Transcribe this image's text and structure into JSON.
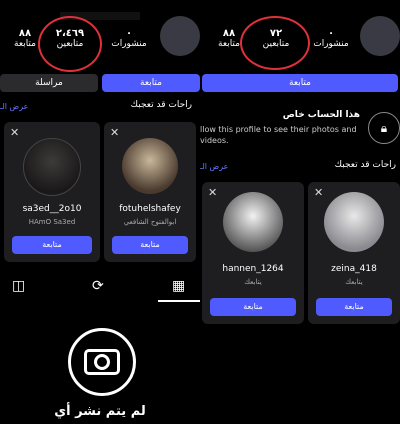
{
  "left": {
    "stats": {
      "posts_count": "٠",
      "posts_label": "منشورات",
      "followers_count": "٢،٤٦٩",
      "followers_label": "متابعين",
      "following_count": "٨٨",
      "following_label": "متابعة"
    },
    "buttons": {
      "message": "مراسلة",
      "follow": "متابعة"
    },
    "suggested": {
      "title": "راحات قد تعجبك",
      "see_all": "عرض الـ"
    },
    "cards": [
      {
        "username": "fotuhelshafey",
        "subtitle": "ابوالفتوح الشافعي",
        "button": "متابعة"
      },
      {
        "username": "sa3ed__2o10",
        "subtitle": "HAmO Sa3ed",
        "button": "متابعة"
      }
    ],
    "empty": {
      "text": "لم يتم نشر أي"
    }
  },
  "right": {
    "stats": {
      "posts_count": "٠",
      "posts_label": "منشورات",
      "followers_count": "٧٢",
      "followers_label": "متابعين",
      "following_count": "٨٨",
      "following_label": "متابعة"
    },
    "buttons": {
      "follow": "متابعة"
    },
    "private": {
      "title": "هذا الحساب خاص",
      "text": "llow this profile to see their photos and videos."
    },
    "suggested": {
      "title": "راحات قد تعجبك",
      "see_all": "عرض الـ"
    },
    "cards": [
      {
        "username": "zeina_418",
        "subtitle": "يتابعك",
        "button": "متابعة"
      },
      {
        "username": "hannen_1264",
        "subtitle": "يتابعك",
        "button": "متابعة"
      }
    ]
  },
  "colors": {
    "accent": "#4f5bff",
    "annotation": "#e0303a",
    "card_bg": "#1e1e20"
  }
}
